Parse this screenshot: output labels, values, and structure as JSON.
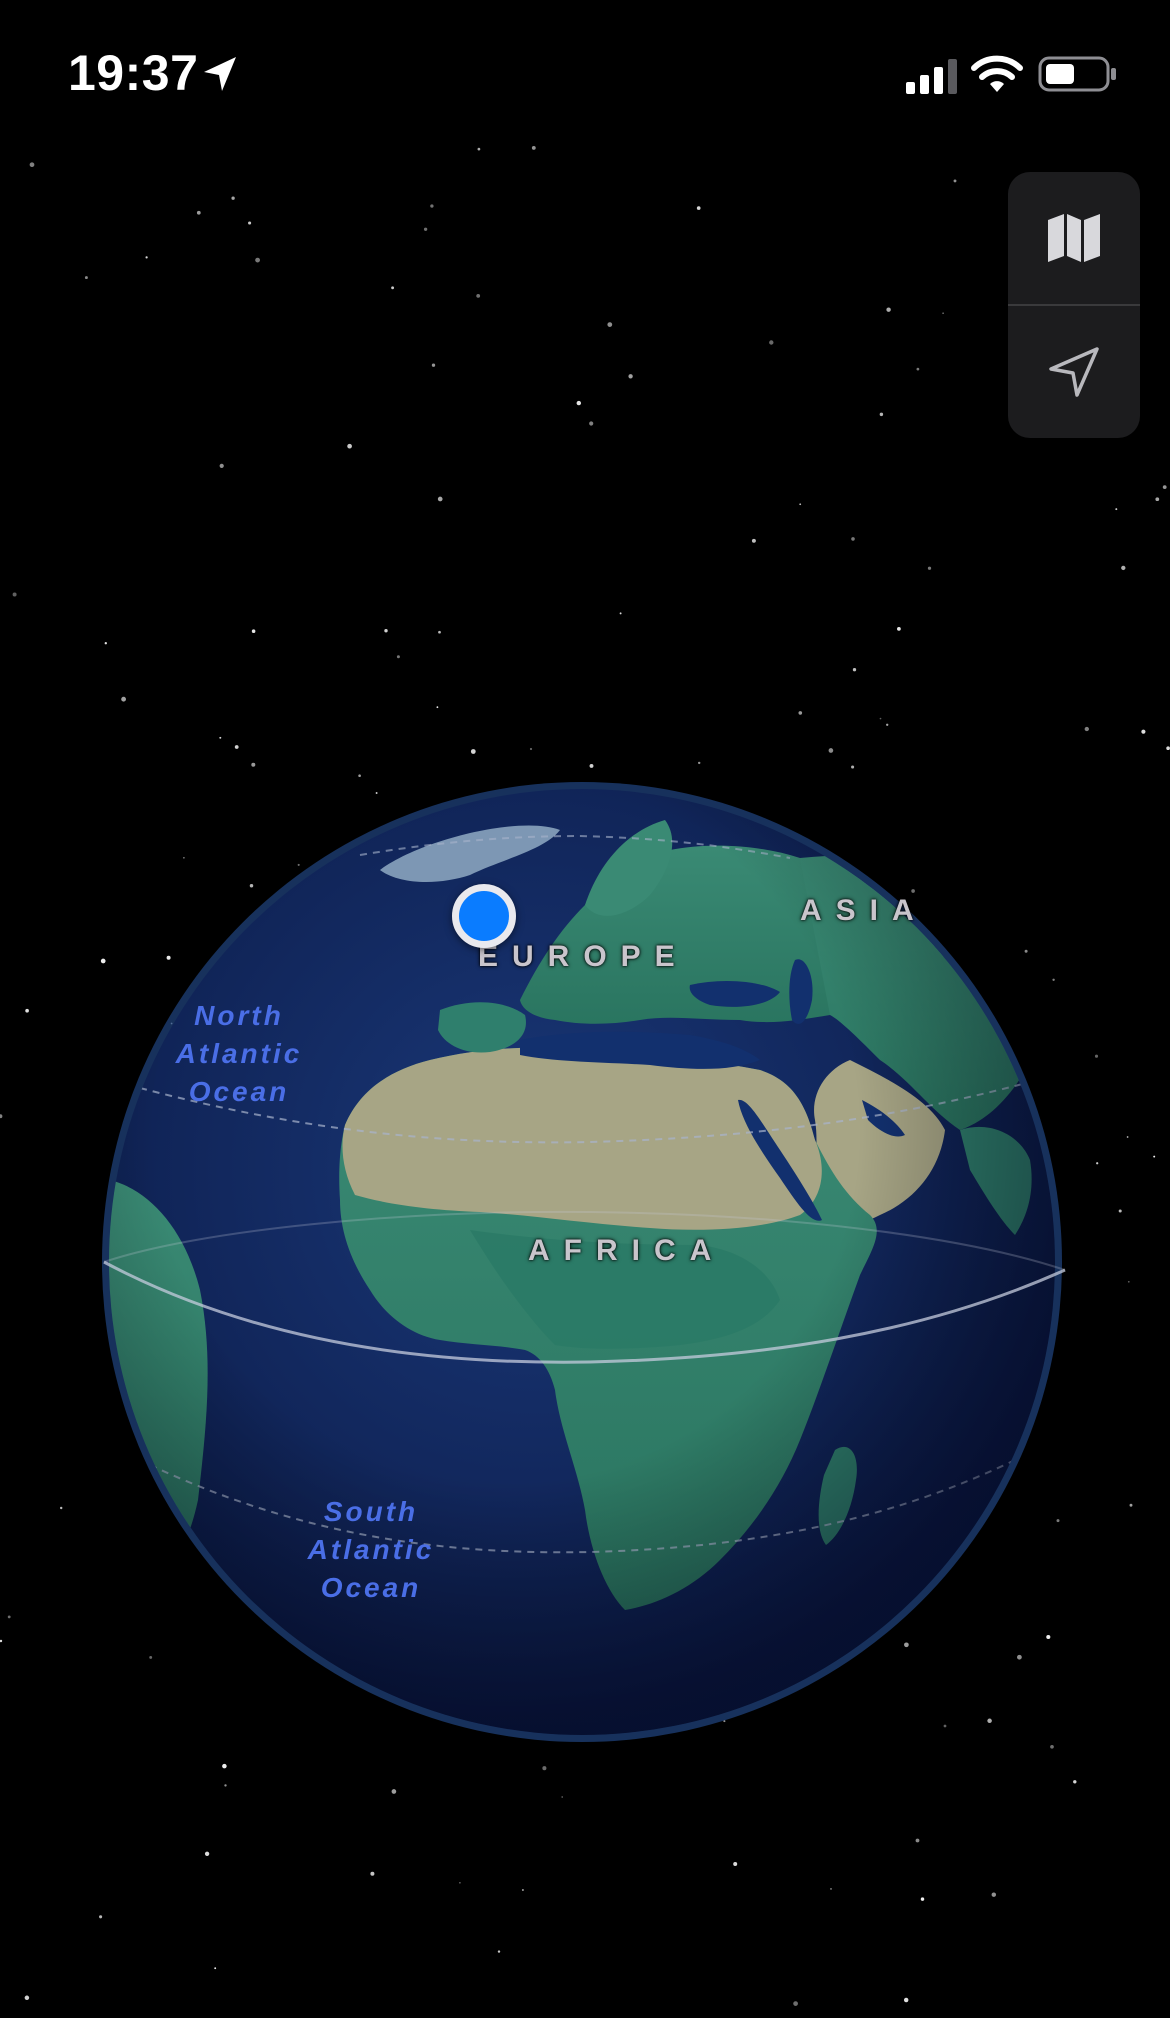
{
  "status_bar": {
    "time": "19:37",
    "location_icon": "location-arrow-icon",
    "signal_icon": "cellular-signal-icon",
    "wifi_icon": "wifi-icon",
    "battery_icon": "battery-icon",
    "battery_level": 0.5
  },
  "map_controls": {
    "map_mode_icon": "map-icon",
    "locate_icon": "location-arrow-icon"
  },
  "labels": {
    "europe": "EUROPE",
    "asia": "ASIA",
    "africa": "AFRICA",
    "north_atlantic": [
      "North",
      "Atlantic",
      "Ocean"
    ],
    "south_atlantic": [
      "South",
      "Atlantic",
      "Ocean"
    ]
  },
  "colors": {
    "background": "#000000",
    "ocean": "#10245a",
    "land_green": "#2f7f6d",
    "desert": "#a7a585",
    "ocean_label": "#4a6ee6",
    "user_location": "#0a7cff",
    "control_panel": "#1c1c1e"
  }
}
